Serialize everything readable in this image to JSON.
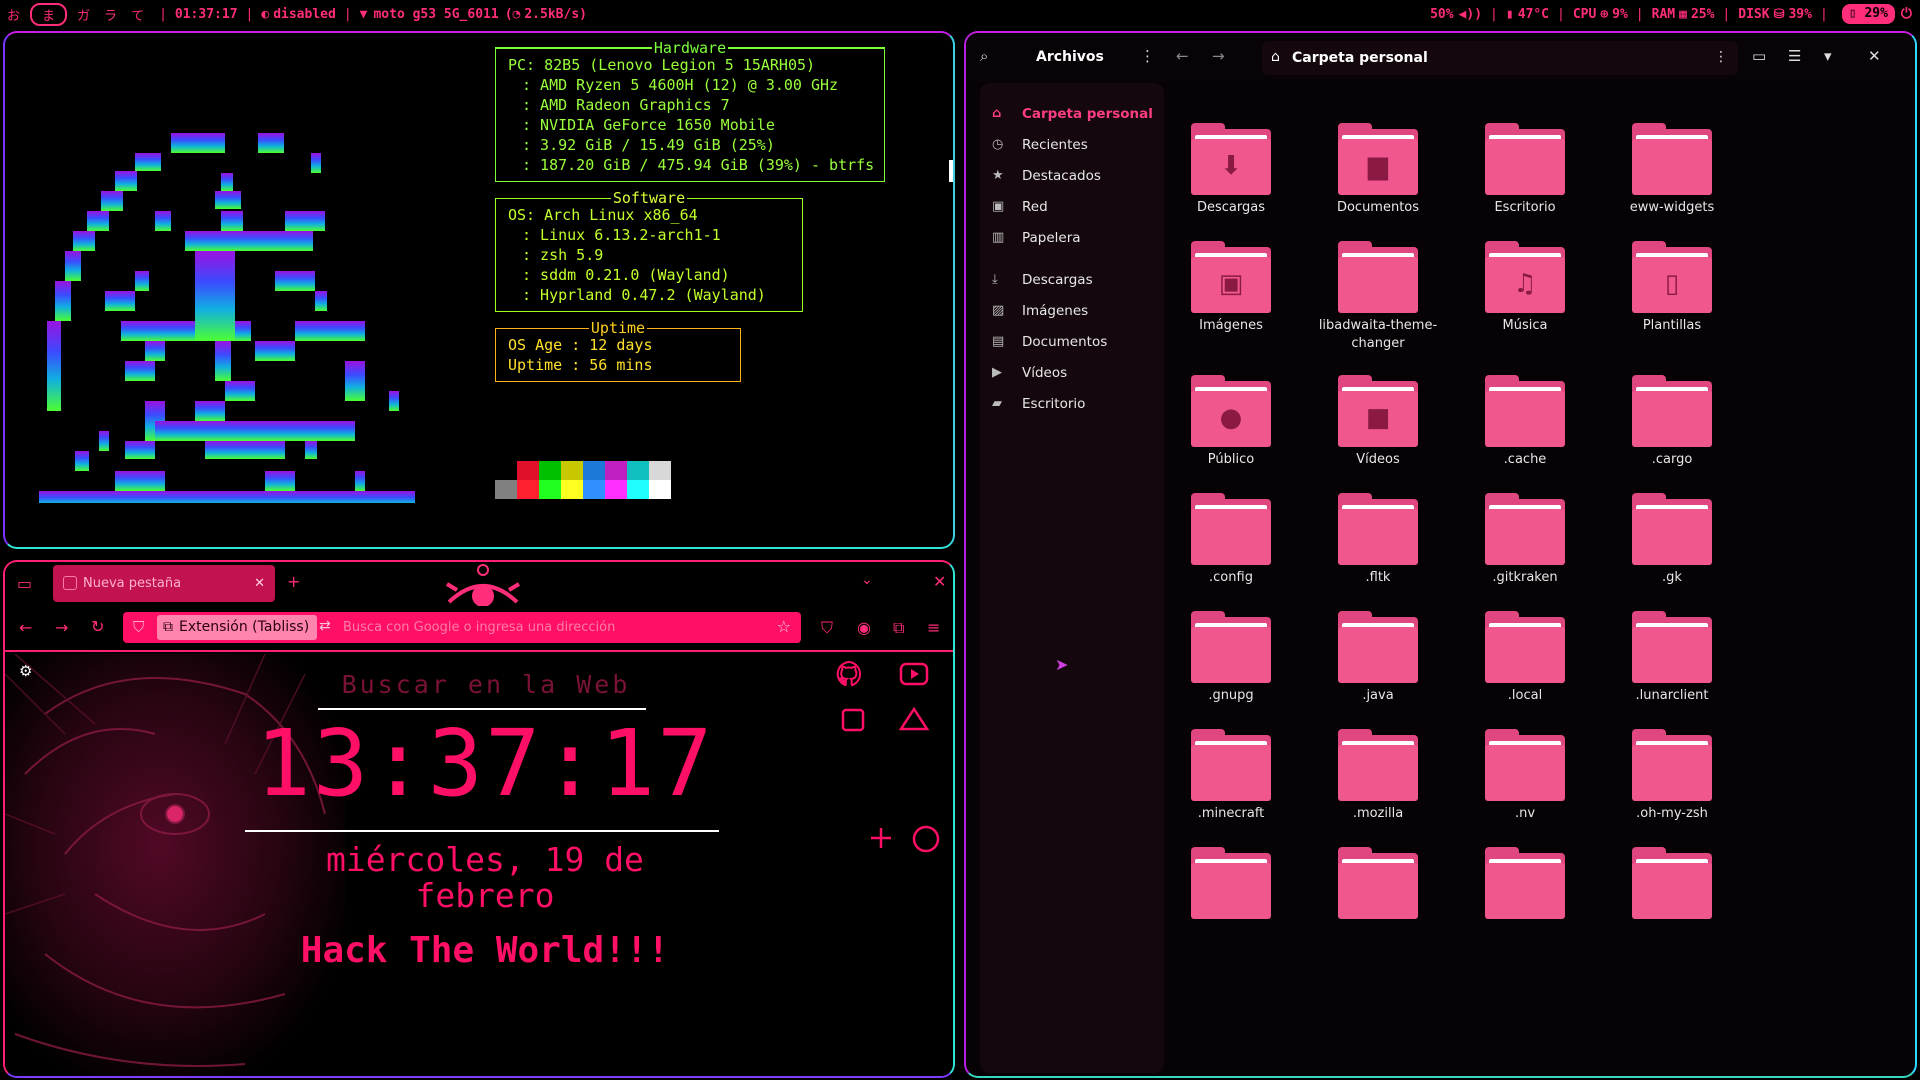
{
  "topbar": {
    "workspaces": [
      "お",
      "ま",
      "ガ",
      "ラ",
      "て"
    ],
    "active_workspace": 1,
    "time": "01:37:17",
    "idle": "disabled",
    "wifi": "moto g53 5G_6011",
    "net_speed": "2.5kB/s",
    "volume": "50%",
    "temp": "47°C",
    "cpu": "9%",
    "ram": "25%",
    "disk": "39%",
    "battery": "29%"
  },
  "fastfetch": {
    "hardware_title": "Hardware",
    "hardware": [
      "PC: 82B5 (Lenovo Legion 5 15ARH05)",
      ": AMD Ryzen 5 4600H (12) @ 3.00 GHz",
      ": AMD Radeon Graphics 7",
      ": NVIDIA GeForce 1650 Mobile",
      ": 3.92 GiB / 15.49 GiB (25%)",
      ": 187.20 GiB / 475.94 GiB (39%) - btrfs"
    ],
    "software_title": "Software",
    "software": [
      "OS: Arch Linux x86_64",
      ": Linux 6.13.2-arch1-1",
      ": zsh 5.9",
      ": sddm 0.21.0 (Wayland)",
      ": Hyprland 0.47.2 (Wayland)"
    ],
    "uptime_title": "Uptime",
    "uptime": [
      "OS Age : 12 days",
      "Uptime : 56 mins"
    ],
    "palette_top": [
      "#000000",
      "#e0102a",
      "#00c000",
      "#c8c800",
      "#1e78d8",
      "#c020c0",
      "#10c0c0",
      "#d8d8d8"
    ],
    "palette_bottom": [
      "#808080",
      "#ff2030",
      "#20ff20",
      "#ffff20",
      "#3090ff",
      "#ff30ff",
      "#20ffff",
      "#ffffff"
    ]
  },
  "browser": {
    "tab_title": "Nueva pestaña",
    "extension_label": "Extensión (Tabliss)",
    "url_placeholder": "Busca con Google o ingresa una dirección",
    "search_label": "Buscar en la Web",
    "clock": "13:37:17",
    "date": "miércoles, 19 de febrero",
    "slogan": "Hack The World!!!"
  },
  "files": {
    "app_title": "Archivos",
    "path": "Carpeta personal",
    "sidebar": [
      {
        "label": "Carpeta personal",
        "icon": "home-icon",
        "selected": true
      },
      {
        "label": "Recientes",
        "icon": "clock-icon"
      },
      {
        "label": "Destacados",
        "icon": "star-icon"
      },
      {
        "label": "Red",
        "icon": "network-icon"
      },
      {
        "label": "Papelera",
        "icon": "trash-icon"
      },
      {
        "label": "Descargas",
        "icon": "download-icon"
      },
      {
        "label": "Imágenes",
        "icon": "image-icon"
      },
      {
        "label": "Documentos",
        "icon": "document-icon"
      },
      {
        "label": "Vídeos",
        "icon": "video-icon"
      },
      {
        "label": "Escritorio",
        "icon": "folder-icon"
      }
    ],
    "items": [
      {
        "label": "Descargas",
        "glyph": "⬇"
      },
      {
        "label": "Documentos",
        "glyph": "▆"
      },
      {
        "label": "Escritorio",
        "glyph": ""
      },
      {
        "label": "eww-widgets",
        "glyph": ""
      },
      {
        "label": "Imágenes",
        "glyph": "▣"
      },
      {
        "label": "libadwaita-theme-changer",
        "glyph": ""
      },
      {
        "label": "Música",
        "glyph": "♫"
      },
      {
        "label": "Plantillas",
        "glyph": "▯"
      },
      {
        "label": "Público",
        "glyph": "●"
      },
      {
        "label": "Vídeos",
        "glyph": "■"
      },
      {
        "label": ".cache",
        "glyph": ""
      },
      {
        "label": ".cargo",
        "glyph": ""
      },
      {
        "label": ".config",
        "glyph": ""
      },
      {
        "label": ".fltk",
        "glyph": ""
      },
      {
        "label": ".gitkraken",
        "glyph": ""
      },
      {
        "label": ".gk",
        "glyph": ""
      },
      {
        "label": ".gnupg",
        "glyph": ""
      },
      {
        "label": ".java",
        "glyph": ""
      },
      {
        "label": ".local",
        "glyph": ""
      },
      {
        "label": ".lunarclient",
        "glyph": ""
      },
      {
        "label": ".minecraft",
        "glyph": ""
      },
      {
        "label": ".mozilla",
        "glyph": ""
      },
      {
        "label": ".nv",
        "glyph": ""
      },
      {
        "label": ".oh-my-zsh",
        "glyph": ""
      },
      {
        "label": "",
        "glyph": ""
      },
      {
        "label": "",
        "glyph": ""
      },
      {
        "label": "",
        "glyph": ""
      },
      {
        "label": "",
        "glyph": ""
      }
    ]
  },
  "colors": {
    "accent": "#ff0f66",
    "folder": "#f0578f",
    "terminal_green": "#7dff3a"
  }
}
